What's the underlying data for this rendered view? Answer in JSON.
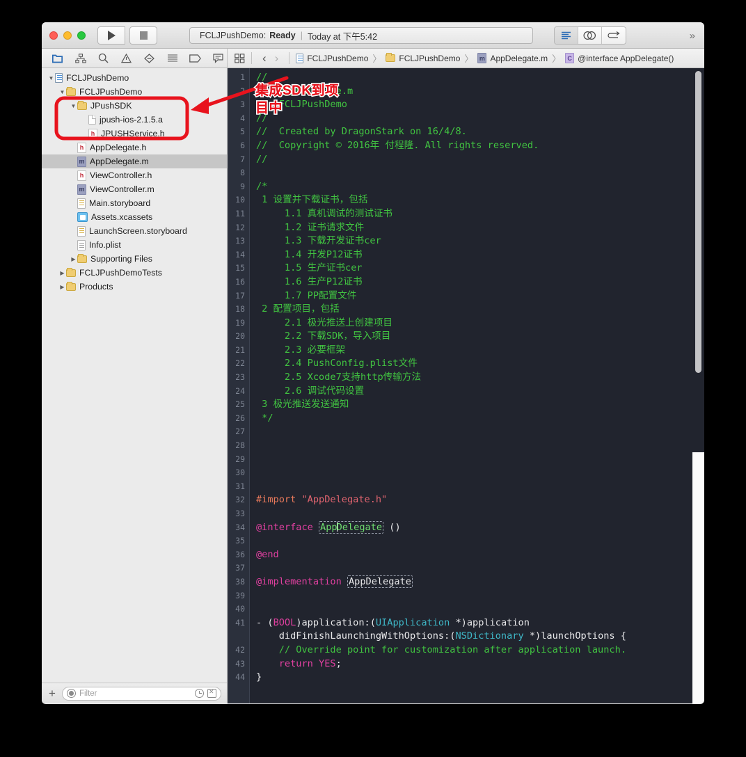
{
  "window": {
    "traffic_lights": [
      "close",
      "minimize",
      "maximize"
    ],
    "run_label": "Run",
    "stop_label": "Stop",
    "status": {
      "scheme": "FCLJPushDemo:",
      "state": "Ready",
      "separator": "|",
      "time": "Today at 下午5:42"
    },
    "editor_modes": [
      "standard-editor",
      "assistant-editor",
      "version-editor"
    ],
    "overflow": "»"
  },
  "navigator_toolbar": {
    "icons": [
      {
        "name": "project-navigator-icon",
        "active": true
      },
      {
        "name": "symbol-navigator-icon",
        "active": false
      },
      {
        "name": "search-navigator-icon",
        "active": false
      },
      {
        "name": "issue-navigator-icon",
        "active": false
      },
      {
        "name": "breakpoint-navigator-icon",
        "active": false
      },
      {
        "name": "report-navigator-icon",
        "active": false
      },
      {
        "name": "test-navigator-icon",
        "active": false
      },
      {
        "name": "debug-navigator-icon",
        "active": false
      }
    ]
  },
  "jumpbar": {
    "grid_icon": "related-items-icon",
    "back": "‹",
    "forward": "›",
    "crumbs": [
      {
        "label": "FCLJPushDemo",
        "icon": "project-icon"
      },
      {
        "label": "FCLJPushDemo",
        "icon": "folder-icon"
      },
      {
        "label": "AppDelegate.m",
        "icon": "objc-m-file-icon"
      },
      {
        "label": "@interface AppDelegate()",
        "icon": "interface-icon"
      }
    ],
    "separator": "〉"
  },
  "sidebar": {
    "tree": [
      {
        "label": "FCLJPushDemo",
        "depth": 0,
        "icon": "project",
        "twisty": "open",
        "selected": false
      },
      {
        "label": "FCLJPushDemo",
        "depth": 1,
        "icon": "folder",
        "twisty": "open",
        "selected": false
      },
      {
        "label": "JPushSDK",
        "depth": 2,
        "icon": "folder",
        "twisty": "open",
        "selected": false
      },
      {
        "label": "jpush-ios-2.1.5.a",
        "depth": 3,
        "icon": "blank",
        "twisty": "none",
        "selected": false
      },
      {
        "label": "JPUSHService.h",
        "depth": 3,
        "icon": "h",
        "twisty": "none",
        "selected": false
      },
      {
        "label": "AppDelegate.h",
        "depth": 2,
        "icon": "h",
        "twisty": "none",
        "selected": false
      },
      {
        "label": "AppDelegate.m",
        "depth": 2,
        "icon": "m",
        "twisty": "none",
        "selected": true
      },
      {
        "label": "ViewController.h",
        "depth": 2,
        "icon": "h",
        "twisty": "none",
        "selected": false
      },
      {
        "label": "ViewController.m",
        "depth": 2,
        "icon": "m",
        "twisty": "none",
        "selected": false
      },
      {
        "label": "Main.storyboard",
        "depth": 2,
        "icon": "sb",
        "twisty": "none",
        "selected": false
      },
      {
        "label": "Assets.xcassets",
        "depth": 2,
        "icon": "assets",
        "twisty": "none",
        "selected": false
      },
      {
        "label": "LaunchScreen.storyboard",
        "depth": 2,
        "icon": "sb",
        "twisty": "none",
        "selected": false
      },
      {
        "label": "Info.plist",
        "depth": 2,
        "icon": "plist",
        "twisty": "none",
        "selected": false
      },
      {
        "label": "Supporting Files",
        "depth": 2,
        "icon": "folder",
        "twisty": "closed",
        "selected": false
      },
      {
        "label": "FCLJPushDemoTests",
        "depth": 1,
        "icon": "folder",
        "twisty": "closed",
        "selected": false
      },
      {
        "label": "Products",
        "depth": 1,
        "icon": "folder",
        "twisty": "closed",
        "selected": false
      }
    ],
    "footer": {
      "add_label": "+",
      "filter_placeholder": "Filter",
      "scope_icon": "filter-scope-icon",
      "recent_icon": "recent-files-icon",
      "modified_icon": "source-control-filter-icon"
    }
  },
  "editor": {
    "line_numbers": [
      1,
      2,
      3,
      4,
      5,
      6,
      7,
      8,
      9,
      10,
      11,
      12,
      13,
      14,
      15,
      16,
      17,
      18,
      19,
      20,
      21,
      22,
      23,
      24,
      25,
      26,
      27,
      28,
      29,
      30,
      31,
      32,
      33,
      34,
      35,
      36,
      37,
      38,
      39,
      40,
      41,
      42,
      43,
      44
    ],
    "lines": [
      {
        "n": 1,
        "segs": [
          {
            "t": "//",
            "c": "cm"
          }
        ]
      },
      {
        "n": 2,
        "segs": [
          {
            "t": "//  AppDelegate.m",
            "c": "cm"
          }
        ]
      },
      {
        "n": 3,
        "segs": [
          {
            "t": "//  FCLJPushDemo",
            "c": "cm"
          }
        ]
      },
      {
        "n": 4,
        "segs": [
          {
            "t": "//",
            "c": "cm"
          }
        ]
      },
      {
        "n": 5,
        "segs": [
          {
            "t": "//  Created by DragonStark on 16/4/8.",
            "c": "cm"
          }
        ]
      },
      {
        "n": 6,
        "segs": [
          {
            "t": "//  Copyright © 2016年 付程隆. All rights reserved.",
            "c": "cm"
          }
        ]
      },
      {
        "n": 7,
        "segs": [
          {
            "t": "//",
            "c": "cm"
          }
        ]
      },
      {
        "n": 8,
        "segs": []
      },
      {
        "n": 9,
        "segs": [
          {
            "t": "/*",
            "c": "cm"
          }
        ]
      },
      {
        "n": 10,
        "segs": [
          {
            "t": " 1 设置并下载证书，包括",
            "c": "cm"
          }
        ]
      },
      {
        "n": 11,
        "segs": [
          {
            "t": "     1.1 真机调试的测试证书",
            "c": "cm"
          }
        ]
      },
      {
        "n": 12,
        "segs": [
          {
            "t": "     1.2 证书请求文件",
            "c": "cm"
          }
        ]
      },
      {
        "n": 13,
        "segs": [
          {
            "t": "     1.3 下载开发证书cer",
            "c": "cm"
          }
        ]
      },
      {
        "n": 14,
        "segs": [
          {
            "t": "     1.4 开发P12证书",
            "c": "cm"
          }
        ]
      },
      {
        "n": 15,
        "segs": [
          {
            "t": "     1.5 生产证书cer",
            "c": "cm"
          }
        ]
      },
      {
        "n": 16,
        "segs": [
          {
            "t": "     1.6 生产P12证书",
            "c": "cm"
          }
        ]
      },
      {
        "n": 17,
        "segs": [
          {
            "t": "     1.7 PP配置文件",
            "c": "cm"
          }
        ]
      },
      {
        "n": 18,
        "segs": [
          {
            "t": " 2 配置项目，包括",
            "c": "cm"
          }
        ]
      },
      {
        "n": 19,
        "segs": [
          {
            "t": "     2.1 极光推送上创建项目",
            "c": "cm"
          }
        ]
      },
      {
        "n": 20,
        "segs": [
          {
            "t": "     2.2 下载SDK，导入项目",
            "c": "cm"
          }
        ]
      },
      {
        "n": 21,
        "segs": [
          {
            "t": "     2.3 必要框架",
            "c": "cm"
          }
        ]
      },
      {
        "n": 22,
        "segs": [
          {
            "t": "     2.4 PushConfig.plist文件",
            "c": "cm"
          }
        ]
      },
      {
        "n": 23,
        "segs": [
          {
            "t": "     2.5 Xcode7支持http传输方法",
            "c": "cm"
          }
        ]
      },
      {
        "n": 24,
        "segs": [
          {
            "t": "     2.6 调试代码设置",
            "c": "cm"
          }
        ]
      },
      {
        "n": 25,
        "segs": [
          {
            "t": " 3 极光推送发送通知",
            "c": "cm"
          }
        ]
      },
      {
        "n": 26,
        "segs": [
          {
            "t": " */",
            "c": "cm"
          }
        ]
      },
      {
        "n": 27,
        "segs": []
      },
      {
        "n": 28,
        "segs": []
      },
      {
        "n": 29,
        "segs": []
      },
      {
        "n": 30,
        "segs": []
      },
      {
        "n": 31,
        "segs": []
      },
      {
        "n": 32,
        "segs": [
          {
            "t": "#import ",
            "c": "pre"
          },
          {
            "t": "\"AppDelegate.h\"",
            "c": "str"
          }
        ]
      },
      {
        "n": 33,
        "segs": []
      },
      {
        "n": 34,
        "segs": [
          {
            "t": "@interface ",
            "c": "kw"
          },
          {
            "t": "AppDelegate",
            "c": "tok-caret"
          },
          {
            "t": " ()",
            "c": "pl"
          }
        ]
      },
      {
        "n": 35,
        "segs": []
      },
      {
        "n": 36,
        "segs": [
          {
            "t": "@end",
            "c": "kw"
          }
        ]
      },
      {
        "n": 37,
        "segs": []
      },
      {
        "n": 38,
        "segs": [
          {
            "t": "@implementation ",
            "c": "kw"
          },
          {
            "t": "AppDelegate",
            "c": "tok"
          }
        ]
      },
      {
        "n": 39,
        "segs": []
      },
      {
        "n": 40,
        "segs": []
      },
      {
        "n": 41,
        "segs": [
          {
            "t": "- (",
            "c": "pl"
          },
          {
            "t": "BOOL",
            "c": "kw"
          },
          {
            "t": ")application:(",
            "c": "pl"
          },
          {
            "t": "UIApplication",
            "c": "ty"
          },
          {
            "t": " *)application",
            "c": "pl"
          }
        ]
      },
      {
        "n": 41,
        "cont": true,
        "segs": [
          {
            "t": "    didFinishLaunchingWithOptions:(",
            "c": "pl"
          },
          {
            "t": "NSDictionary",
            "c": "ty"
          },
          {
            "t": " *)launchOptions {",
            "c": "pl"
          }
        ]
      },
      {
        "n": 42,
        "segs": [
          {
            "t": "    // Override point for customization after application launch.",
            "c": "cm"
          }
        ]
      },
      {
        "n": 43,
        "segs": [
          {
            "t": "    ",
            "c": "pl"
          },
          {
            "t": "return YES",
            "c": "kw"
          },
          {
            "t": ";",
            "c": "pl"
          }
        ]
      },
      {
        "n": 44,
        "segs": [
          {
            "t": "}",
            "c": "pl"
          }
        ]
      }
    ],
    "scrollbar": {
      "thumb_top_pct": 0,
      "thumb_height_pct": 48
    }
  },
  "annotation": {
    "callout_text_line1": "集成SDK到项",
    "callout_text_line2": "目中",
    "highlight_box": "JPushSDK folder and its files",
    "color": "#e8131d"
  }
}
